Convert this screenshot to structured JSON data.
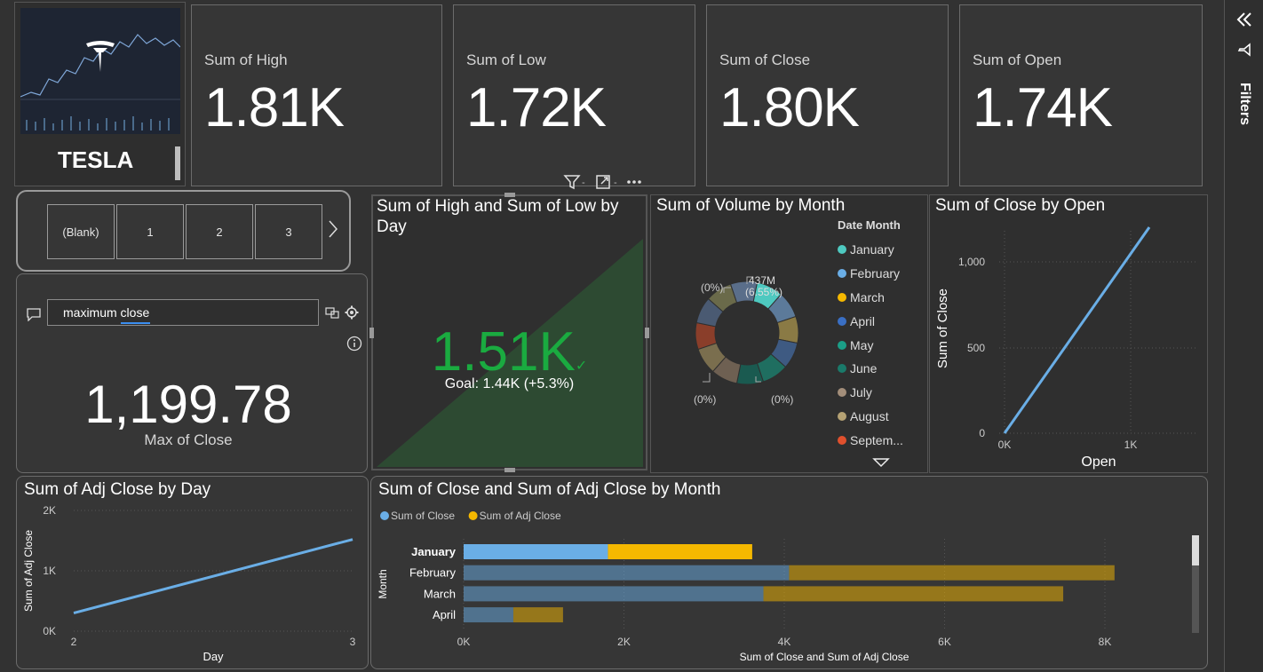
{
  "logo": {
    "brand": "TESLA"
  },
  "kpis": [
    {
      "label": "Sum of High",
      "value": "1.81K"
    },
    {
      "label": "Sum of Low",
      "value": "1.72K"
    },
    {
      "label": "Sum of Close",
      "value": "1.80K"
    },
    {
      "label": "Sum of Open",
      "value": "1.74K"
    }
  ],
  "slicer": {
    "items": [
      "(Blank)",
      "1",
      "2",
      "3"
    ]
  },
  "qa": {
    "query": "maximum close",
    "value": "1,199.78",
    "caption": "Max of Close"
  },
  "gauge": {
    "title": "Sum of High and Sum of Low by Day",
    "value": "1.51K",
    "goal": "Goal: 1.44K (+5.3%)",
    "colors": {
      "fill": "#2d4a32",
      "value": "#1aab40"
    }
  },
  "donut": {
    "title": "Sum of Volume by Month",
    "legend_title": "Date Month",
    "legend": [
      {
        "label": "January",
        "color": "#4ec9c0"
      },
      {
        "label": "February",
        "color": "#6aaee6"
      },
      {
        "label": "March",
        "color": "#f5b800"
      },
      {
        "label": "April",
        "color": "#3a6fc4"
      },
      {
        "label": "May",
        "color": "#1b9e87"
      },
      {
        "label": "June",
        "color": "#1a7a6a"
      },
      {
        "label": "July",
        "color": "#a38e7a"
      },
      {
        "label": "August",
        "color": "#b5a274"
      },
      {
        "label": "Septem...",
        "color": "#e0502d"
      }
    ],
    "labels": {
      "top_value": "437M",
      "top_pct": "(6.55%)",
      "top_left": "(0%)",
      "bottom_left": "(0%)",
      "bottom_right": "(0%)"
    }
  },
  "scatter": {
    "title": "Sum of Close by Open",
    "xlabel": "Open",
    "ylabel": "Sum of Close",
    "xticks": [
      "0K",
      "1K"
    ],
    "yticks": [
      "0",
      "500",
      "1,000"
    ],
    "color": "#6aaee6"
  },
  "chart_data": [
    {
      "type": "line",
      "title": "Sum of Adj Close by Day",
      "xlabel": "Day",
      "ylabel": "Sum of Adj Close",
      "x": [
        2,
        3
      ],
      "series": [
        {
          "values": [
            300,
            1520
          ]
        }
      ],
      "xticks": [
        "2",
        "3"
      ],
      "yticks": [
        "0K",
        "1K",
        "2K"
      ],
      "ylim": [
        0,
        2000
      ],
      "color": "#6aaee6"
    },
    {
      "type": "bar",
      "orientation": "horizontal",
      "stacked": true,
      "title": "Sum of Close and Sum of Adj Close by Month",
      "xlabel": "Sum of Close and Sum of Adj Close",
      "ylabel": "Month",
      "categories": [
        "January",
        "February",
        "March",
        "April"
      ],
      "series": [
        {
          "name": "Sum of Close",
          "values": [
            1800,
            4060,
            3740,
            620
          ],
          "color": "#6aaee6"
        },
        {
          "name": "Sum of Adj Close",
          "values": [
            1800,
            4060,
            3740,
            620
          ],
          "color": "#f5b800"
        }
      ],
      "xticks": [
        "0K",
        "2K",
        "4K",
        "6K",
        "8K"
      ],
      "xlim": [
        0,
        8000
      ],
      "highlighted": "January"
    }
  ],
  "filters": {
    "label": "Filters"
  }
}
